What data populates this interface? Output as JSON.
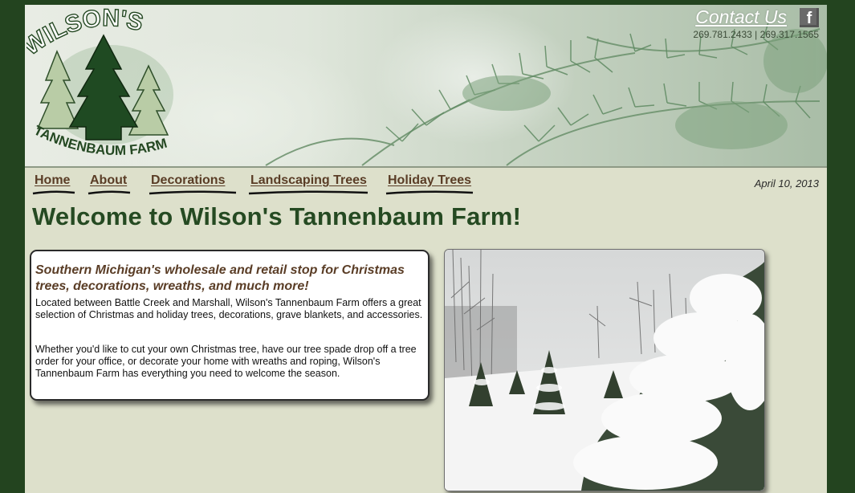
{
  "header": {
    "logo_top": "WILSON'S",
    "logo_bottom": "TANNENBAUM FARM",
    "contact_label": "Contact Us",
    "facebook_glyph": "f",
    "phones": "269.781.2433 | 269.317.1565"
  },
  "nav": {
    "items": [
      {
        "label": "Home"
      },
      {
        "label": "About"
      },
      {
        "label": "Decorations"
      },
      {
        "label": "Landscaping Trees"
      },
      {
        "label": "Holiday Trees"
      }
    ]
  },
  "date": "April 10, 2013",
  "main": {
    "title": "Welcome to Wilson's Tannenbaum Farm!",
    "lead": "Southern Michigan's wholesale and retail stop for Christmas trees, decorations, wreaths, and much more!",
    "paragraph1": "Located between Battle Creek and Marshall, Wilson's Tannenbaum Farm offers a great selection of Christmas and holiday trees, decorations, grave blankets, and accessories.",
    "paragraph2": "Whether you'd like to cut your own Christmas tree, have our tree spade drop off a tree order for your office, or decorate your home with wreaths and roping, Wilson's Tannenbaum Farm has everything you need to welcome the season."
  },
  "colors": {
    "frame": "#23441f",
    "page_bg": "#dde0cb",
    "nav_text": "#5a3d26",
    "title": "#254a22"
  },
  "icons": [
    "facebook-icon",
    "pine-tree-logo"
  ]
}
